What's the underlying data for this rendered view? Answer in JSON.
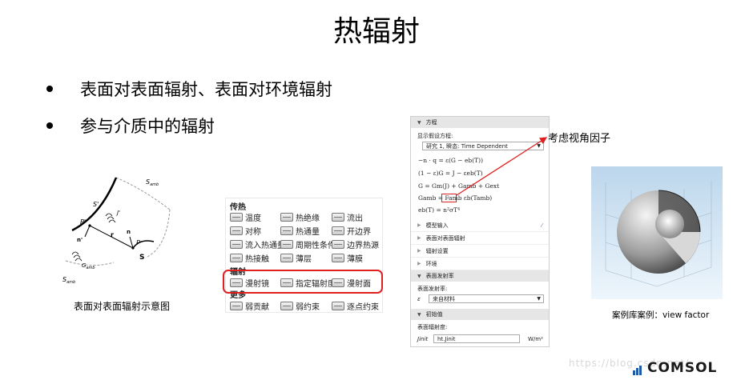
{
  "slide": {
    "title": "热辐射",
    "bullets": [
      "表面对表面辐射、表面对环境辐射",
      "参与介质中的辐射"
    ]
  },
  "diagram": {
    "caption": "表面对表面辐射示意图",
    "labels": {
      "s_amb_top": "S",
      "s_prime": "S'",
      "p_prime": "P'",
      "n_prime": "n'",
      "r": "r",
      "p": "P",
      "n": "n",
      "s": "S",
      "j_prime": "J'",
      "g_amb_sym": "G",
      "s_amb_bottom": "S"
    },
    "sub": "amb"
  },
  "features": {
    "section1": "传热",
    "items1": [
      "温度",
      "热绝缘",
      "流出",
      "对称",
      "热通量",
      "开边界",
      "流入热通量",
      "周期性条件",
      "边界热源",
      "热接触",
      "薄层",
      "薄膜"
    ],
    "section2": "辐射",
    "items2": [
      "漫射镜",
      "指定辐射度",
      "漫射面"
    ],
    "section3": "更多",
    "items3": [
      "弱贡献",
      "弱约束",
      "逐点约束"
    ]
  },
  "settings": {
    "eq_header": "方程",
    "eq_label": "显示假设方程:",
    "eq_select": "研究 1, 瞬态: Time Dependent",
    "equations": [
      "−n · q = ε(G − eb(T))",
      "(1 − ε)G = J − εeb(T)",
      "G = Gm(J) + Gamb + Gext",
      "Gamb = Famb εb(Tamb)",
      "eb(T) = n²σT⁴"
    ],
    "sections": [
      "模型输入",
      "表面对表面辐射",
      "辐射设置",
      "环境"
    ],
    "emis_header": "表面发射率",
    "emis_label": "表面发射率:",
    "emis_sym": "ε",
    "emis_select": "来自材料",
    "init_header": "初始值",
    "init_label": "表面辐射度:",
    "init_sym": "Jinit",
    "init_value": "ht.Jinit",
    "init_unit": "W/m²"
  },
  "annotation": {
    "text": "考虑视角因子"
  },
  "case": {
    "caption": "案例库案例：view factor"
  },
  "footer": {
    "watermark": "https://blog.csdn.net/",
    "brand": "COMSOL"
  },
  "colors": {
    "highlight": "#e02020",
    "panel_header": "#e6e6e6"
  }
}
